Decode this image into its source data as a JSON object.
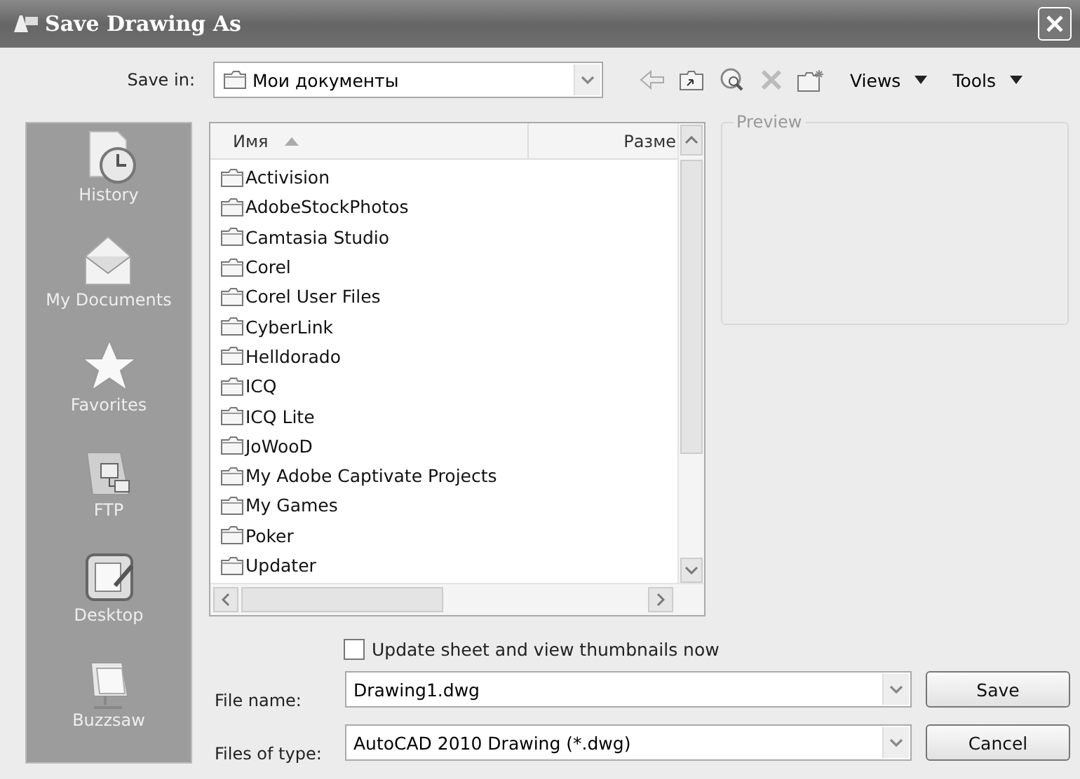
{
  "window": {
    "title": "Save Drawing As"
  },
  "save_in": {
    "label": "Save in:",
    "value": "Мои документы"
  },
  "toolbar": {
    "menus": [
      {
        "label": "Views"
      },
      {
        "label": "Tools"
      }
    ]
  },
  "places": [
    {
      "kind": "history",
      "label": "History"
    },
    {
      "kind": "documents",
      "label": "My Documents"
    },
    {
      "kind": "favorites",
      "label": "Favorites"
    },
    {
      "kind": "ftp",
      "label": "FTP"
    },
    {
      "kind": "desktop",
      "label": "Desktop"
    },
    {
      "kind": "buzzsaw",
      "label": "Buzzsaw"
    }
  ],
  "file_list": {
    "columns": [
      {
        "label": "Имя",
        "sorted": true
      },
      {
        "label": "Разме",
        "sorted": false
      }
    ],
    "rows": [
      {
        "name": "Activision"
      },
      {
        "name": "AdobeStockPhotos"
      },
      {
        "name": "Camtasia Studio"
      },
      {
        "name": "Corel"
      },
      {
        "name": "Corel User Files"
      },
      {
        "name": "CyberLink"
      },
      {
        "name": "Helldorado"
      },
      {
        "name": "ICQ"
      },
      {
        "name": "ICQ Lite"
      },
      {
        "name": "JoWooD"
      },
      {
        "name": "My Adobe Captivate Projects"
      },
      {
        "name": "My Games"
      },
      {
        "name": "Poker"
      },
      {
        "name": "Updater"
      }
    ]
  },
  "preview": {
    "label": "Preview"
  },
  "thumbnails": {
    "label": "Update sheet and view thumbnails now",
    "checked": false
  },
  "file_name": {
    "label": "File name:",
    "value": "Drawing1.dwg"
  },
  "file_type": {
    "label": "Files of type:",
    "value": "AutoCAD 2010 Drawing (*.dwg)"
  },
  "buttons": [
    {
      "label": "Save"
    },
    {
      "label": "Cancel"
    }
  ]
}
